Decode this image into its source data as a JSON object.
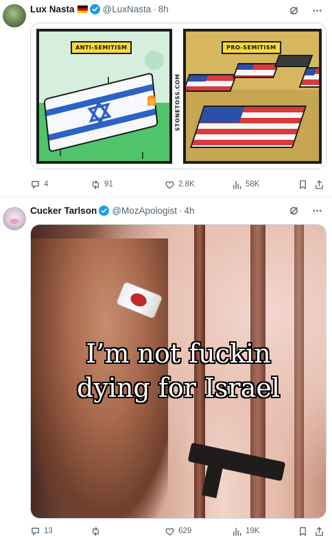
{
  "tweets": [
    {
      "name": "Lux Nasta",
      "handle": "@LuxNasta",
      "dot": "·",
      "time": "8h",
      "comic": {
        "left_label": "ANTI-SEMITISM",
        "right_label": "PRO-SEMITISM",
        "watermark": "STONETOSS.COM"
      },
      "stats": {
        "replies": "4",
        "reposts": "91",
        "likes": "2.8K",
        "views": "58K"
      }
    },
    {
      "name": "Cucker Tarlson",
      "handle": "@MozApologist",
      "dot": "·",
      "time": "4h",
      "caption_line1": "I’m not fuckin",
      "caption_line2": "dying for Israel",
      "stats": {
        "replies": "13",
        "reposts": "",
        "likes": "629",
        "views": "19K"
      }
    }
  ],
  "icons": {
    "verified": "verified-badge-icon",
    "grok": "grok-icon",
    "more": "more-icon",
    "reply": "reply-icon",
    "repost": "repost-icon",
    "like": "like-icon",
    "views": "views-icon",
    "bookmark": "bookmark-icon",
    "share": "share-icon"
  },
  "colors": {
    "accent": "#1d9bf0",
    "secondary_text": "#536471",
    "border": "#cfd9de"
  }
}
